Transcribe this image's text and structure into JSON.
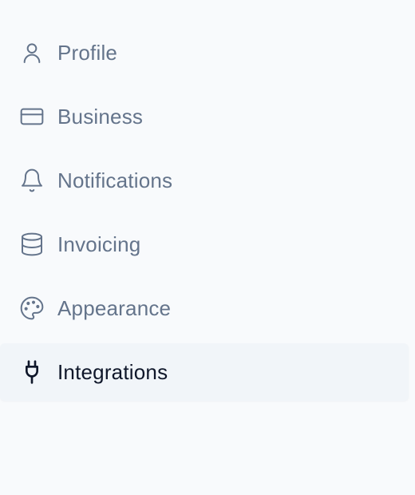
{
  "sidebar": {
    "items": [
      {
        "label": "Profile",
        "icon": "user-icon",
        "active": false
      },
      {
        "label": "Business",
        "icon": "credit-card-icon",
        "active": false
      },
      {
        "label": "Notifications",
        "icon": "bell-icon",
        "active": false
      },
      {
        "label": "Invoicing",
        "icon": "database-icon",
        "active": false
      },
      {
        "label": "Appearance",
        "icon": "palette-icon",
        "active": false
      },
      {
        "label": "Integrations",
        "icon": "plug-icon",
        "active": true
      }
    ]
  },
  "colors": {
    "background": "#f8fafc",
    "inactive_text": "#64748b",
    "active_text": "#0f172a",
    "active_background": "#f1f5f9"
  }
}
